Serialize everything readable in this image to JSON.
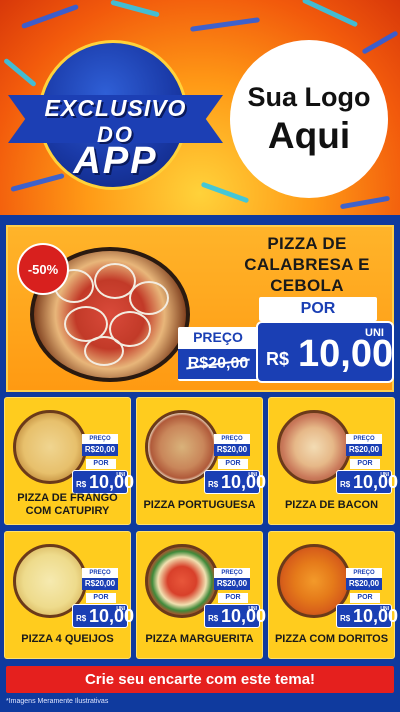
{
  "header": {
    "badge_line1": "EXCLUSIVO",
    "badge_line2": "DO",
    "badge_line3": "APP",
    "logo_line1": "Sua Logo",
    "logo_line2": "Aqui"
  },
  "featured": {
    "discount": "-50%",
    "name_lines": [
      "PIZZA DE",
      "CALABRESA E",
      "CEBOLA"
    ],
    "por_label": "POR",
    "preco_label": "PREÇO",
    "old_price": "R$20,00",
    "currency": "R$",
    "new_price": "10,00",
    "unit": "UNI"
  },
  "grid_prices": {
    "preco_label": "PREÇO",
    "old_price": "R$20,00",
    "por_label": "POR",
    "currency": "R$",
    "new_price": "10,00",
    "unit": "UNI"
  },
  "products": [
    {
      "name": "PIZZA DE FRANGO COM CATUPIRY"
    },
    {
      "name": "PIZZA PORTUGUESA"
    },
    {
      "name": "PIZZA DE BACON"
    },
    {
      "name": "PIZZA 4 QUEIJOS"
    },
    {
      "name": "PIZZA MARGUERITA"
    },
    {
      "name": "PIZZA COM DORITOS"
    }
  ],
  "cta": "Crie seu encarte com este tema!",
  "disclaimer": "*Imagens Meramente Ilustrativas",
  "colors": {
    "accent_blue": "#1a3fb4",
    "yellow": "#ffcc1e",
    "orange": "#ff9a12",
    "red": "#e5201e"
  }
}
